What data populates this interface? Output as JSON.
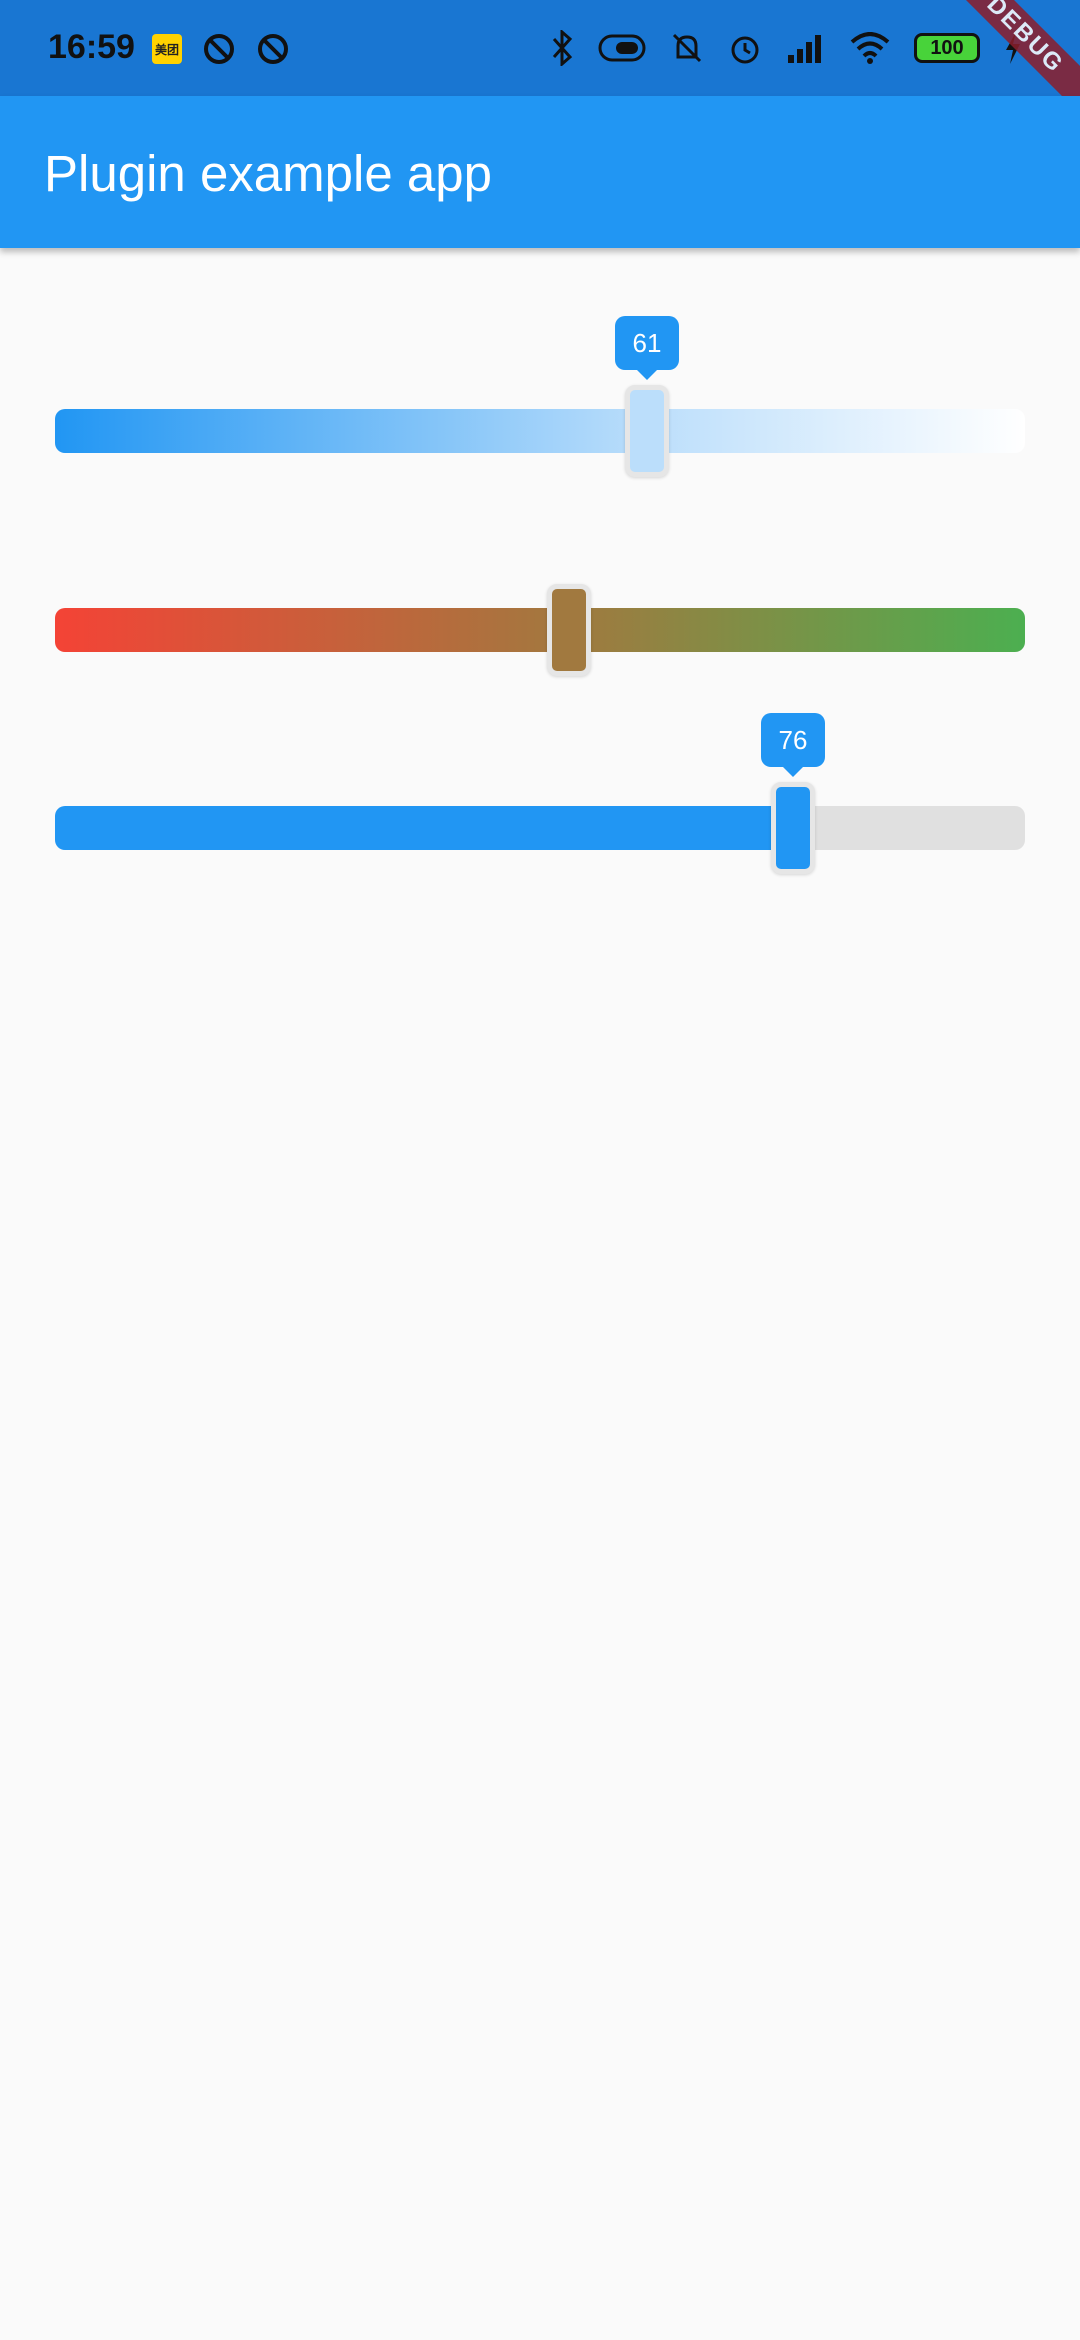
{
  "status_bar": {
    "time": "16:59",
    "app_badge": "美团",
    "battery": "100",
    "icons": [
      "target-icon",
      "target-icon",
      "bluetooth-icon",
      "toggle-icon",
      "muted-bell-icon",
      "alarm-icon",
      "signal-hd-icon",
      "wifi-icon",
      "battery-icon",
      "charging-icon"
    ]
  },
  "debug_banner": "DEBUG",
  "app_bar": {
    "title": "Plugin example app"
  },
  "sliders": [
    {
      "value": 61,
      "fraction": 0.61,
      "label": "61",
      "track_colors": [
        "#2196f3",
        "#ffffff"
      ],
      "thumb_color": "#bbdefb"
    },
    {
      "value_fraction": 0.53,
      "track_colors": [
        "#f44336",
        "#4caf50"
      ],
      "thumb_color": "#a1793f"
    },
    {
      "value": 76,
      "fraction": 0.76,
      "label": "76",
      "active_color": "#2196f3",
      "inactive_color": "#e0e0e0",
      "thumb_color": "#2196f3"
    }
  ]
}
